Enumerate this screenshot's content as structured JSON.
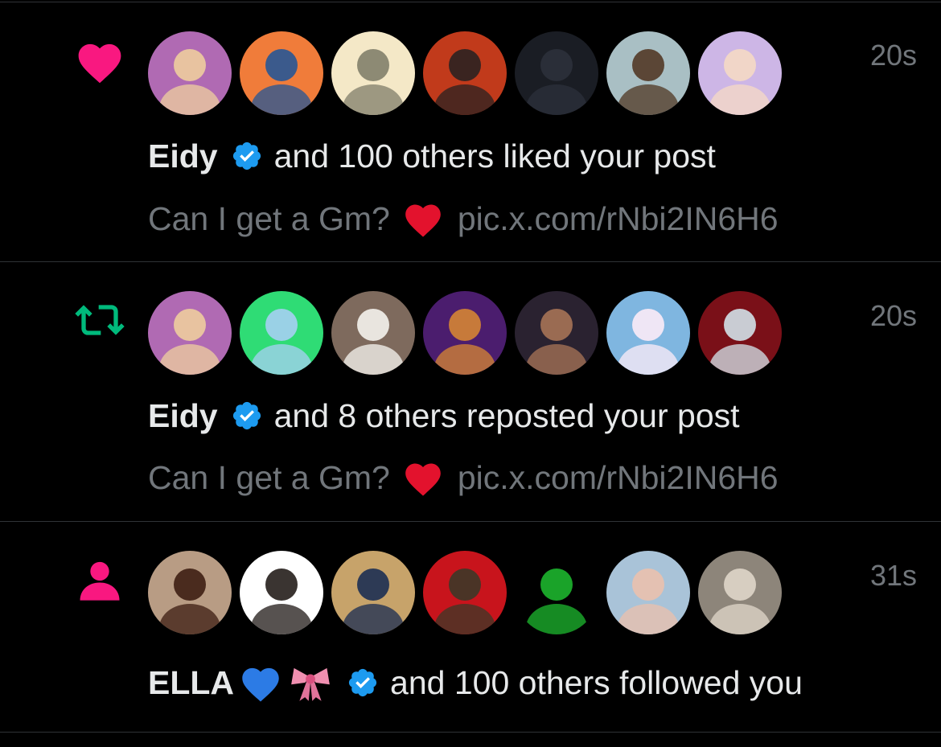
{
  "colors": {
    "background": "#000000",
    "text": "#e7e9ea",
    "muted": "#71767b",
    "like": "#f91880",
    "repost": "#00ba7c",
    "follow": "#f91880",
    "verified": "#1d9bf0",
    "divider": "#2f3336"
  },
  "notifications": [
    {
      "type": "like",
      "icon": "heart-icon",
      "time": "20s",
      "name": "Eidy",
      "action": "and 100 others liked your post",
      "preview_text": "Can I get a Gm?",
      "preview_link": "pic.x.com/rNbi2IN6H6",
      "avatars": [
        {
          "bg": "#b06ab3",
          "fg": "#e8c3a0"
        },
        {
          "bg": "#f07c3a",
          "fg": "#3b5a8c"
        },
        {
          "bg": "#f4e8c7",
          "fg": "#8d8a74"
        },
        {
          "bg": "#c13a1b",
          "fg": "#3a2420"
        },
        {
          "bg": "#1a1d24",
          "fg": "#2a2e38"
        },
        {
          "bg": "#a9bfc4",
          "fg": "#5b4636"
        },
        {
          "bg": "#cdb6e6",
          "fg": "#f1d6c8"
        }
      ]
    },
    {
      "type": "repost",
      "icon": "repost-icon",
      "time": "20s",
      "name": "Eidy",
      "action": "and 8 others reposted your post",
      "preview_text": "Can I get a Gm?",
      "preview_link": "pic.x.com/rNbi2IN6H6",
      "avatars": [
        {
          "bg": "#b06ab3",
          "fg": "#e8c3a0"
        },
        {
          "bg": "#2fdc75",
          "fg": "#9ad1e6"
        },
        {
          "bg": "#7e6a5d",
          "fg": "#e9e5df"
        },
        {
          "bg": "#4b1d6e",
          "fg": "#c77a3a"
        },
        {
          "bg": "#2a2230",
          "fg": "#9a6b52"
        },
        {
          "bg": "#7fb6e0",
          "fg": "#efe6f5"
        },
        {
          "bg": "#7a1018",
          "fg": "#c9ccd3"
        }
      ]
    },
    {
      "type": "follow",
      "icon": "person-icon",
      "time": "31s",
      "name": "ELLA",
      "action": "and 100 others followed you",
      "avatars": [
        {
          "bg": "#b89c84",
          "fg": "#4a2b1e"
        },
        {
          "bg": "#ffffff",
          "fg": "#3a3431"
        },
        {
          "bg": "#c7a36a",
          "fg": "#2d3a55"
        },
        {
          "bg": "#c8141c",
          "fg": "#4a3426"
        },
        {
          "bg": "#000000",
          "fg": "#1aa329"
        },
        {
          "bg": "#a9c3d8",
          "fg": "#e4c1b2"
        },
        {
          "bg": "#8d857a",
          "fg": "#d7cec1"
        }
      ]
    }
  ]
}
